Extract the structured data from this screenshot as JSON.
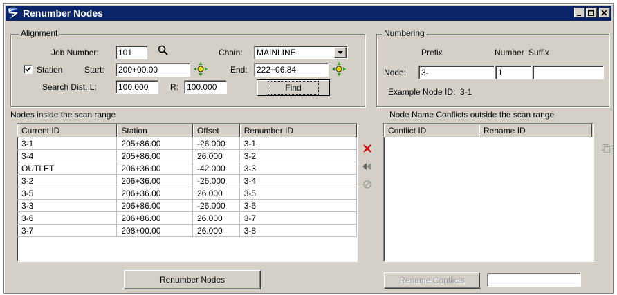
{
  "window": {
    "title": "Renumber Nodes"
  },
  "alignment": {
    "legend": "Alignment",
    "job_number_label": "Job Number:",
    "job_number_value": "101",
    "chain_label": "Chain:",
    "chain_value": "MAINLINE",
    "station_checkbox_label": "Station",
    "station_checked": true,
    "start_label": "Start:",
    "start_value": "200+00.00",
    "end_label": "End:",
    "end_value": "222+06.84",
    "search_dist_label": "Search Dist. L:",
    "search_dist_l_value": "100.000",
    "r_label": "R:",
    "search_dist_r_value": "100.000",
    "find_label": "Find"
  },
  "numbering": {
    "legend": "Numbering",
    "prefix_label": "Prefix",
    "number_label": "Number",
    "suffix_label": "Suffix",
    "node_label": "Node:",
    "prefix_value": "3-",
    "number_value": "1",
    "suffix_value": "",
    "example_label": "Example Node ID:",
    "example_value": "3-1"
  },
  "nodes_table": {
    "caption": "Nodes inside the scan range",
    "columns": [
      "Current ID",
      "Station",
      "Offset",
      "Renumber ID"
    ],
    "rows": [
      [
        "3-1",
        "205+86.00",
        "-26.000",
        "3-1"
      ],
      [
        "3-4",
        "205+86.00",
        "26.000",
        "3-2"
      ],
      [
        "OUTLET",
        "206+36.00",
        "-42.000",
        "3-3"
      ],
      [
        "3-2",
        "206+36.00",
        "-26.000",
        "3-4"
      ],
      [
        "3-5",
        "206+36.00",
        "26.000",
        "3-5"
      ],
      [
        "3-3",
        "206+86.00",
        "-26.000",
        "3-6"
      ],
      [
        "3-6",
        "206+86.00",
        "26.000",
        "3-7"
      ],
      [
        "3-7",
        "208+00.00",
        "26.000",
        "3-8"
      ]
    ]
  },
  "conflicts_table": {
    "caption": "Node Name Conflicts outside the scan range",
    "columns": [
      "Conflict ID",
      "Rename ID"
    ]
  },
  "buttons": {
    "renumber_nodes": "Renumber Nodes",
    "rename_conflicts": "Rename Conflicts",
    "rename_conflicts_value": ""
  },
  "colors": {
    "titlebar": "#0a246a",
    "face": "#d4d0c8",
    "delete_icon": "#cc0000"
  }
}
